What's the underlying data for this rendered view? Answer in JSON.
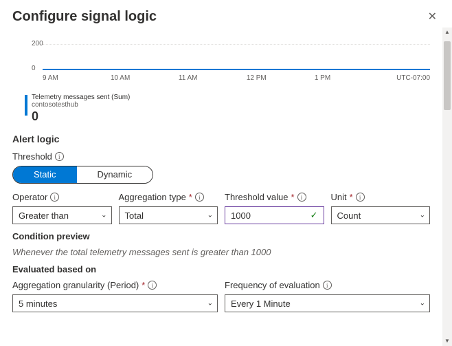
{
  "header": {
    "title": "Configure signal logic"
  },
  "chart_data": {
    "type": "line",
    "title": "",
    "xlabel": "",
    "ylabel": "",
    "ylim": [
      0,
      200
    ],
    "y_ticks": [
      "200",
      "0"
    ],
    "x_ticks": [
      "9 AM",
      "10 AM",
      "11 AM",
      "12 PM",
      "1 PM",
      "UTC-07:00"
    ],
    "series": [
      {
        "name": "Telemetry messages sent (Sum)",
        "resource": "contosotesthub",
        "values": [
          0,
          0,
          0,
          0,
          0,
          0
        ],
        "current": "0",
        "color": "#0078d4"
      }
    ]
  },
  "alert_logic": {
    "section_title": "Alert logic",
    "threshold_label": "Threshold",
    "threshold_toggle": {
      "static": "Static",
      "dynamic": "Dynamic",
      "active": "static"
    },
    "operator": {
      "label": "Operator",
      "value": "Greater than"
    },
    "aggregation_type": {
      "label": "Aggregation type",
      "value": "Total"
    },
    "threshold_value": {
      "label": "Threshold value",
      "value": "1000"
    },
    "unit": {
      "label": "Unit",
      "value": "Count"
    },
    "condition_preview_label": "Condition preview",
    "condition_preview_text": "Whenever the total telemetry messages sent is greater than 1000"
  },
  "evaluated": {
    "section_title": "Evaluated based on",
    "granularity": {
      "label": "Aggregation granularity (Period)",
      "value": "5 minutes"
    },
    "frequency": {
      "label": "Frequency of evaluation",
      "value": "Every 1 Minute"
    }
  }
}
